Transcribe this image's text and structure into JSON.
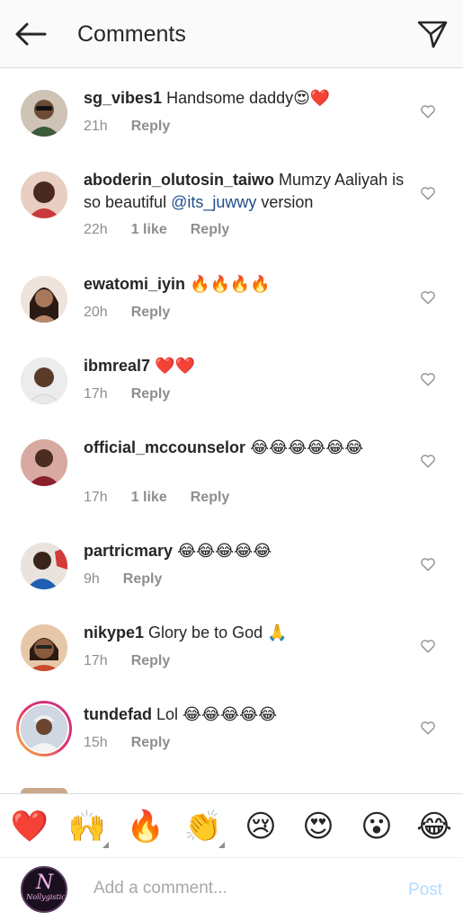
{
  "header": {
    "title": "Comments",
    "back_icon": "back-arrow-icon",
    "send_icon": "paper-plane-icon"
  },
  "comments": [
    {
      "user": "sg_vibes1",
      "text": " Handsome daddy😍❤️",
      "time": "21h",
      "likes": "",
      "reply": "Reply"
    },
    {
      "user": "aboderin_olutosin_taiwo",
      "text": " Mumzy Aaliyah is so beautiful ",
      "mention": "@its_juwwy",
      "text2": " version",
      "time": "22h",
      "likes": "1 like",
      "reply": "Reply"
    },
    {
      "user": "ewatomi_iyin",
      "text": " 🔥🔥🔥🔥",
      "time": "20h",
      "likes": "",
      "reply": "Reply"
    },
    {
      "user": "ibmreal7",
      "text": " ❤️❤️",
      "time": "17h",
      "likes": "",
      "reply": "Reply"
    },
    {
      "user": "official_mccounselor",
      "text": " 😂😂😂😂😂😂",
      "time": "17h",
      "likes": "1 like",
      "reply": "Reply"
    },
    {
      "user": "partricmary",
      "text": " 😂😂😂😂😂",
      "time": "9h",
      "likes": "",
      "reply": "Reply"
    },
    {
      "user": "nikype1",
      "text": " Glory be to God 🙏",
      "time": "17h",
      "likes": "",
      "reply": "Reply"
    },
    {
      "user": "tundefad",
      "text": " Lol 😂😂😂😂😂",
      "time": "15h",
      "likes": "",
      "reply": "Reply"
    }
  ],
  "quick_reactions": [
    "❤️",
    "🙌",
    "🔥",
    "👏",
    "😢",
    "😍",
    "😮",
    "😂"
  ],
  "composer": {
    "placeholder": "Add a comment...",
    "post_label": "Post",
    "avatar_text": "N",
    "avatar_brand": "Nollygistic"
  },
  "colors": {
    "mention": "#1f4e8c",
    "post_disabled": "#b3dbff",
    "secondary": "#8e8e8e"
  }
}
